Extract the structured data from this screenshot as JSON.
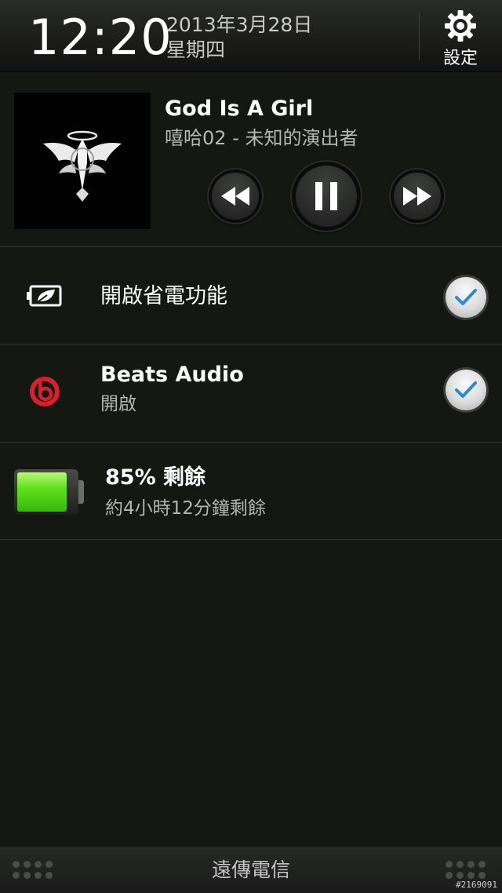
{
  "status_header": {
    "time": "12:20",
    "date": "2013年3月28日",
    "weekday": "星期四",
    "settings_label": "設定",
    "settings_icon": "gear-icon"
  },
  "media_player": {
    "title": "God Is A Girl",
    "subtitle": "嘻哈02 - 未知的演出者",
    "state": "playing",
    "controls": [
      "rewind-icon",
      "pause-icon",
      "fast-forward-icon"
    ]
  },
  "quick_settings": [
    {
      "icon": "power-saver-icon",
      "title": "開啟省電功能",
      "subtitle": "",
      "checked": true
    },
    {
      "icon": "beats-audio-icon",
      "title": "Beats Audio",
      "subtitle": "開啟",
      "checked": true
    }
  ],
  "battery": {
    "level_percent": 85,
    "title": "85% 剩餘",
    "subtitle": "約4小時12分鐘剩餘",
    "fill_color": "#5fe21c"
  },
  "bottom_bar": {
    "carrier": "遠傳電信"
  },
  "watermark": "#2169091",
  "colors": {
    "background": "#151713",
    "check_accent": "#2a8ad6",
    "beats_red": "#d8202a"
  }
}
